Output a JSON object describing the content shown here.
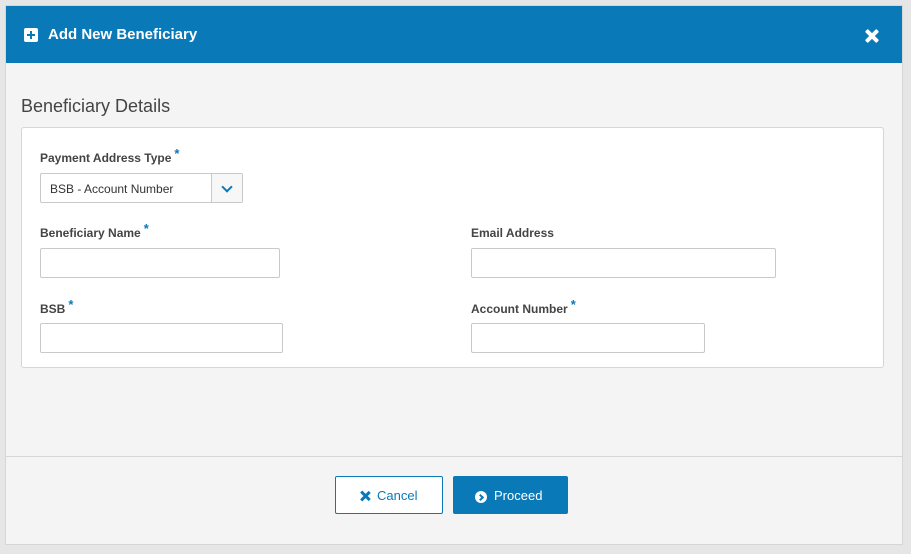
{
  "dialog": {
    "title": "Add New Beneficiary",
    "header_icon": "plus-square-icon",
    "close_icon": "close-icon"
  },
  "section": {
    "title": "Beneficiary Details"
  },
  "form": {
    "payment_address_type": {
      "label": "Payment Address Type",
      "required_mark": "*",
      "selected": "BSB - Account Number",
      "icon": "chevron-down-icon"
    },
    "beneficiary_name": {
      "label": "Beneficiary Name",
      "required_mark": "*",
      "value": ""
    },
    "email_address": {
      "label": "Email Address",
      "value": ""
    },
    "bsb": {
      "label": "BSB",
      "required_mark": "*",
      "value": ""
    },
    "account_number": {
      "label": "Account Number",
      "required_mark": "*",
      "value": ""
    }
  },
  "footer": {
    "cancel_label": "Cancel",
    "cancel_icon": "x-icon",
    "proceed_label": "Proceed",
    "proceed_icon": "arrow-circle-right-icon",
    "accent_color": "#0a79b8"
  }
}
